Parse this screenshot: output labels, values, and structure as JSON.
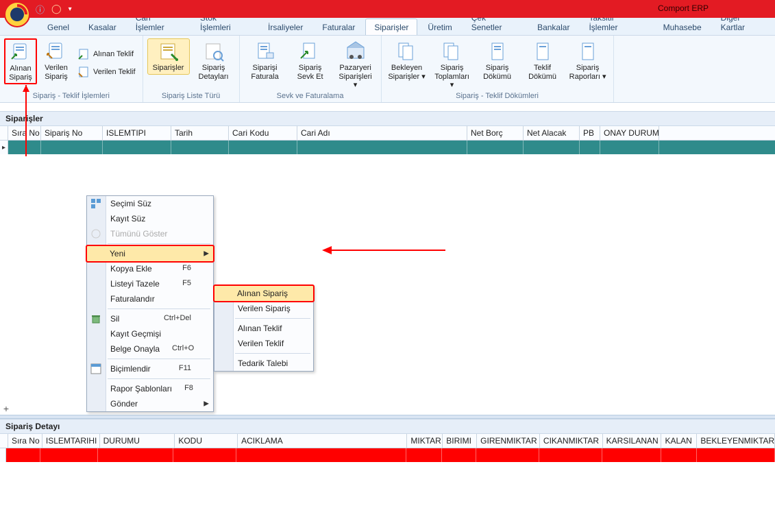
{
  "app": {
    "title": "Comport ERP"
  },
  "menutabs": [
    "Genel",
    "Kasalar",
    "Cari İşlemler",
    "Stok İşlemleri",
    "İrsaliyeler",
    "Faturalar",
    "Siparişler",
    "Üretim",
    "Çek Senetler",
    "Bankalar",
    "Taksitli İşlemler",
    "Muhasebe",
    "Diğer Kartlar"
  ],
  "menutabs_active_index": 6,
  "ribbon": {
    "group1_label": "Sipariş - Teklif İşlemleri",
    "group2_label": "Sipariş Liste Türü",
    "group3_label": "Sevk ve Faturalama",
    "group4_label": "Sipariş - Teklif Dökümleri",
    "alinan_siparis": "Alınan Sipariş",
    "verilen_siparis": "Verilen Sipariş",
    "alinan_teklif": "Alınan Teklif",
    "verilen_teklif": "Verilen Teklif",
    "siparisler": "Siparişler",
    "siparis_detaylari": "Sipariş Detayları",
    "siparisi_faturala": "Siparişi Faturala",
    "siparis_sevket": "Sipariş Sevk Et",
    "pazaryeri": "Pazaryeri Siparişleri",
    "bekleyen": "Bekleyen Siparişler",
    "toplamlari": "Sipariş Toplamları",
    "dokumu": "Sipariş Dökümü",
    "teklif_dokumu": "Teklif Dökümü",
    "raporlari": "Sipariş Raporları"
  },
  "panels": {
    "siparisler": "Siparişler",
    "siparis_detayi": "Sipariş Detayı"
  },
  "grid_top": {
    "cols": [
      "Sıra No",
      "Sipariş No",
      "ISLEMTIPI",
      "Tarih",
      "Cari Kodu",
      "Cari Adı",
      "Net Borç",
      "Net Alacak",
      "PB",
      "ONAY DURUMU"
    ],
    "widths": [
      48,
      90,
      100,
      84,
      100,
      248,
      82,
      82,
      30,
      86
    ]
  },
  "grid_bottom": {
    "cols": [
      "Sıra No",
      "ISLEMTARIHI",
      "DURUMU",
      "KODU",
      "ACIKLAMA",
      "MIKTARI",
      "BIRIMI",
      "GIRENMIKTAR",
      "CIKANMIKTAR",
      "KARSILANAN",
      "KALAN",
      "BEKLEYENMIKTAR"
    ],
    "widths": [
      50,
      84,
      110,
      92,
      248,
      52,
      50,
      92,
      92,
      86,
      52,
      114
    ]
  },
  "ctx": {
    "secimi_suz": "Seçimi Süz",
    "kayit_suz": "Kayıt Süz",
    "tumunu_goster": "Tümünü Göster",
    "yeni": "Yeni",
    "kopya_ekle": "Kopya Ekle",
    "kopya_ekle_sc": "F6",
    "listeyi_tazele": "Listeyi Tazele",
    "listeyi_tazele_sc": "F5",
    "faturalandir": "Faturalandır",
    "sil": "Sil",
    "sil_sc": "Ctrl+Del",
    "kayit_gecmisi": "Kayıt Geçmişi",
    "belge_onayla": "Belge Onayla",
    "belge_onayla_sc": "Ctrl+O",
    "bicimlendir": "Biçimlendir",
    "bicimlendir_sc": "F11",
    "rapor_sablonlari": "Rapor Şablonları",
    "rapor_sablonlari_sc": "F8",
    "gonder": "Gönder",
    "sub_alinan": "Alınan Sipariş",
    "sub_verilen": "Verilen Sipariş",
    "sub_alinan_teklif": "Alınan Teklif",
    "sub_verilen_teklif": "Verilen Teklif",
    "sub_tedarik": "Tedarik Talebi"
  }
}
